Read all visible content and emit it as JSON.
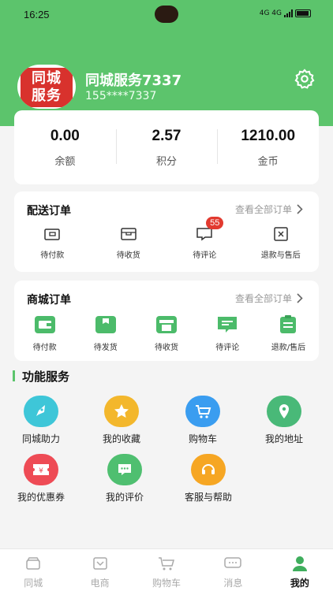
{
  "status": {
    "time": "16:25",
    "net": "4G 4G"
  },
  "profile": {
    "logo_line1": "同城",
    "logo_line2": "服务",
    "name": "同城服务7337",
    "phone": "155****7337"
  },
  "stats": [
    {
      "value": "0.00",
      "label": "余额"
    },
    {
      "value": "2.57",
      "label": "积分"
    },
    {
      "value": "1210.00",
      "label": "金币"
    }
  ],
  "delivery_orders": {
    "title": "配送订单",
    "more": "查看全部订单",
    "items": [
      {
        "label": "待付款",
        "icon": "wallet-icon"
      },
      {
        "label": "待收货",
        "icon": "box-icon"
      },
      {
        "label": "待评论",
        "icon": "comment-icon",
        "badge": "55"
      },
      {
        "label": "退款与售后",
        "icon": "refund-icon"
      }
    ]
  },
  "mall_orders": {
    "title": "商城订单",
    "more": "查看全部订单",
    "items": [
      {
        "label": "待付款",
        "icon": "wallet-icon"
      },
      {
        "label": "待发货",
        "icon": "package-icon"
      },
      {
        "label": "待收货",
        "icon": "store-icon"
      },
      {
        "label": "待评论",
        "icon": "comment-icon"
      },
      {
        "label": "退款/售后",
        "icon": "clipboard-icon"
      }
    ]
  },
  "services": {
    "title": "功能服务",
    "items": [
      {
        "label": "同城助力",
        "icon": "rocket-icon",
        "color": "#3ec6d8"
      },
      {
        "label": "我的收藏",
        "icon": "star-icon",
        "color": "#f3b72c"
      },
      {
        "label": "购物车",
        "icon": "cart-icon",
        "color": "#3a9df0"
      },
      {
        "label": "我的地址",
        "icon": "location-icon",
        "color": "#49b978"
      },
      {
        "label": "我的优惠券",
        "icon": "coupon-icon",
        "color": "#ee4b55"
      },
      {
        "label": "我的评价",
        "icon": "chat-icon",
        "color": "#4fbf70"
      },
      {
        "label": "客服与帮助",
        "icon": "headset-icon",
        "color": "#f6a623"
      }
    ]
  },
  "tabs": [
    {
      "label": "同城",
      "icon": "city-icon"
    },
    {
      "label": "电商",
      "icon": "shop-icon"
    },
    {
      "label": "购物车",
      "icon": "cart-icon"
    },
    {
      "label": "消息",
      "icon": "message-icon"
    },
    {
      "label": "我的",
      "icon": "user-icon",
      "active": true
    }
  ],
  "colors": {
    "brand": "#5cc46c",
    "badge": "#e23a2f"
  }
}
